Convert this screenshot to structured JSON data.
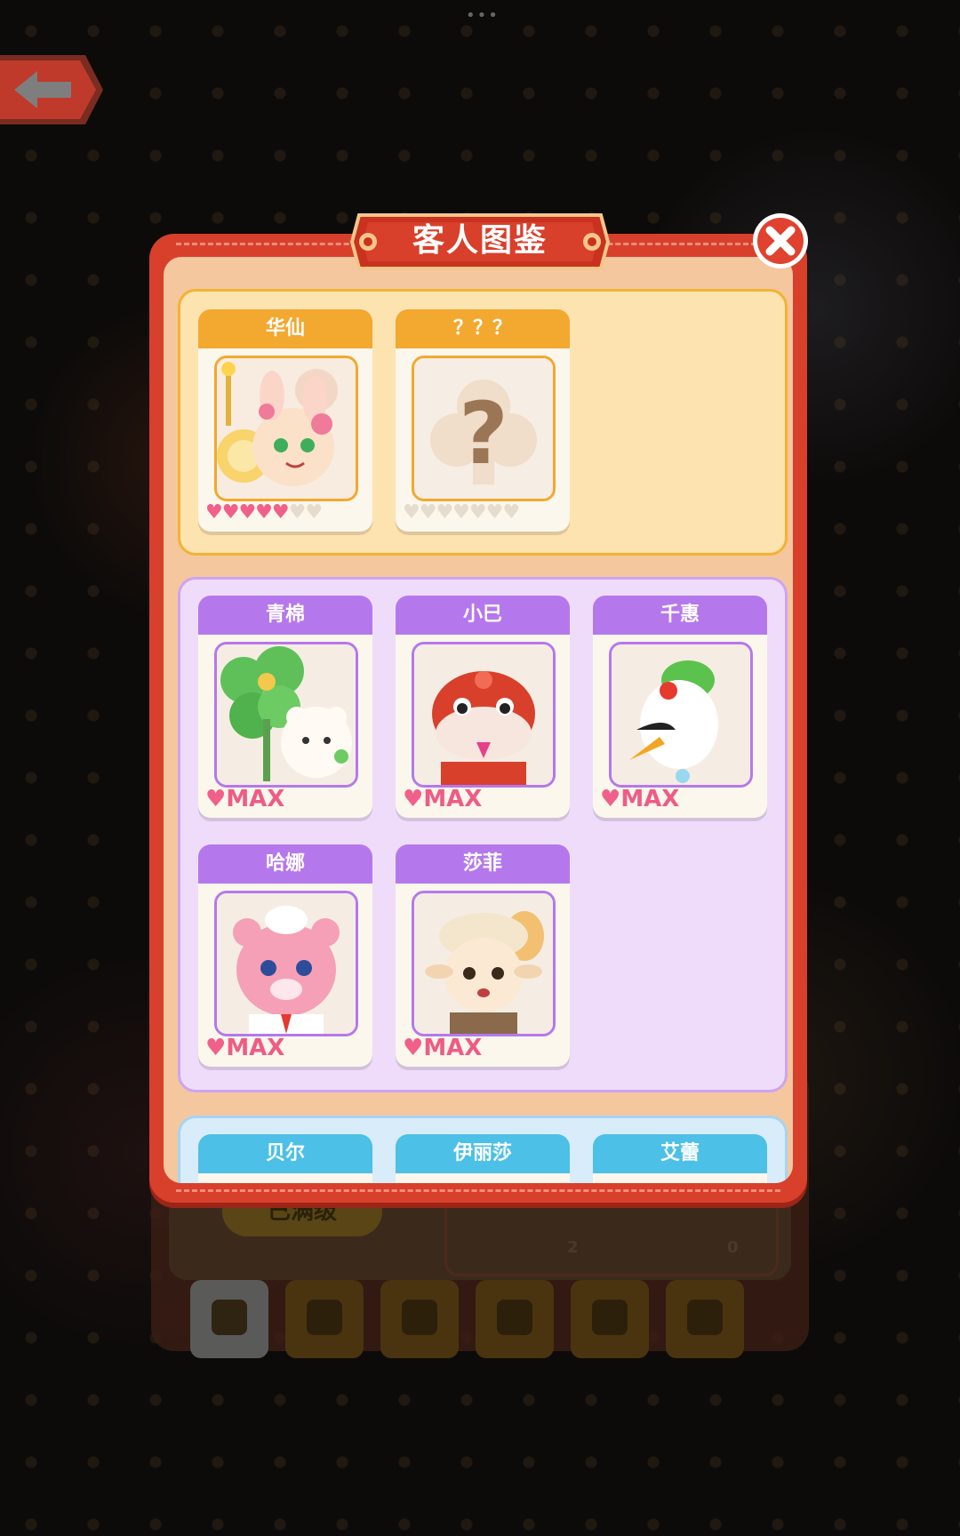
{
  "modal": {
    "title": "客人图鉴"
  },
  "groups": {
    "gold": [
      {
        "name": "华仙",
        "hearts_filled": 5,
        "hearts_total": 7,
        "portrait": "rabbit-fairy"
      },
      {
        "name": "？？？",
        "hearts_filled": 0,
        "hearts_total": 7,
        "portrait": "unknown-question"
      }
    ],
    "purple": [
      {
        "name": "青棉",
        "level": "MAX",
        "portrait": "clover-bear"
      },
      {
        "name": "小巳",
        "level": "MAX",
        "portrait": "red-snake"
      },
      {
        "name": "千惠",
        "level": "MAX",
        "portrait": "crane"
      },
      {
        "name": "哈娜",
        "level": "MAX",
        "portrait": "pink-bear"
      },
      {
        "name": "莎菲",
        "level": "MAX",
        "portrait": "sheep"
      }
    ],
    "blue": [
      {
        "name": "贝尔"
      },
      {
        "name": "伊丽莎"
      },
      {
        "name": "艾蕾"
      }
    ]
  },
  "background": {
    "maxed_button_label": "已满级",
    "stat_left": "2",
    "stat_right": "0"
  },
  "colors": {
    "modal_frame": "#d8402c",
    "gold_header": "#f3a82f",
    "purple_header": "#b578ec",
    "blue_header": "#4cc0e6",
    "heart": "#f0608a"
  }
}
